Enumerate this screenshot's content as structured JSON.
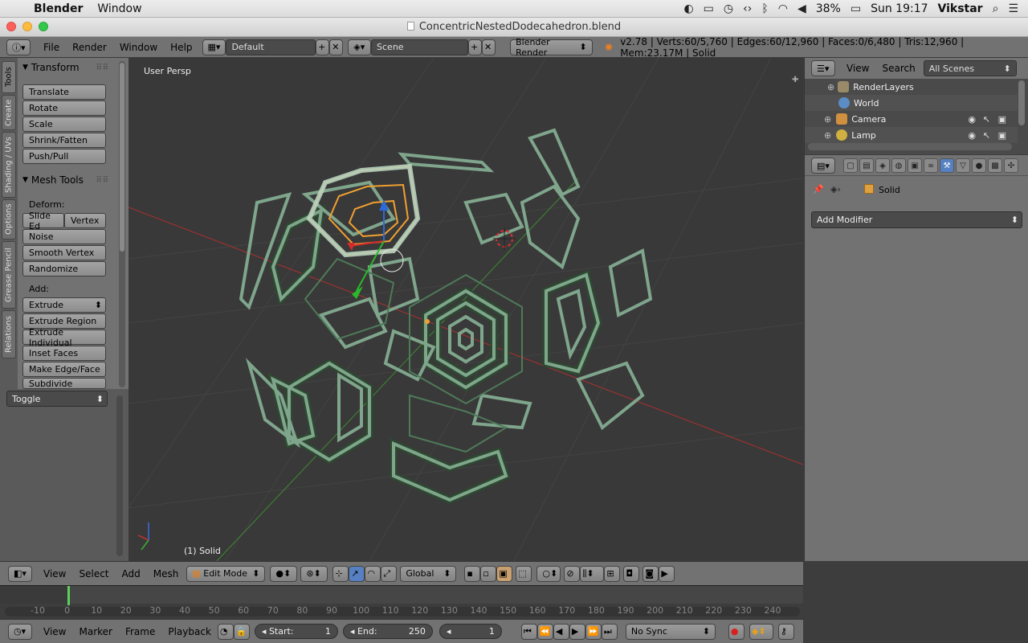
{
  "menubar": {
    "app_name": "Blender",
    "items": [
      "Window"
    ],
    "battery": "38%",
    "clock": "Sun 19:17",
    "user": "Vikstar"
  },
  "titlebar": {
    "title": "ConcentricNestedDodecahedron.blend"
  },
  "info_header": {
    "menus": [
      "File",
      "Render",
      "Window",
      "Help"
    ],
    "layout": "Default",
    "scene": "Scene",
    "engine": "Blender Render",
    "stats": "v2.78 | Verts:60/5,760 | Edges:60/12,960 | Faces:0/6,480 | Tris:12,960 | Mem:23.17M | Solid"
  },
  "tool_tabs": [
    "Tools",
    "Create",
    "Shading / UVs",
    "Options",
    "Grease Pencil",
    "Relations"
  ],
  "tool_shelf": {
    "transform_title": "Transform",
    "transform_buttons": [
      "Translate",
      "Rotate",
      "Scale",
      "Shrink/Fatten",
      "Push/Pull"
    ],
    "mesh_tools_title": "Mesh Tools",
    "deform_label": "Deform:",
    "slide_edge": "Slide Ed",
    "vertex": "Vertex",
    "deform_buttons": [
      "Noise",
      "Smooth Vertex",
      "Randomize"
    ],
    "add_label": "Add:",
    "extrude_select": "Extrude",
    "add_buttons": [
      "Extrude Region",
      "Extrude Individual",
      "Inset Faces",
      "Make Edge/Face",
      "Subdivide"
    ],
    "toggle": "Toggle"
  },
  "viewport": {
    "persp_label": "User Persp",
    "object_label": "(1) Solid"
  },
  "outliner": {
    "view": "View",
    "search": "Search",
    "scenes_select": "All Scenes",
    "rows": [
      "RenderLayers",
      "World",
      "Camera",
      "Lamp"
    ]
  },
  "properties": {
    "object_name": "Solid",
    "add_modifier": "Add Modifier"
  },
  "view3d_header": {
    "menus": [
      "View",
      "Select",
      "Add",
      "Mesh"
    ],
    "mode": "Edit Mode",
    "orientation": "Global"
  },
  "timeline": {
    "ticks": [
      "-10",
      "0",
      "10",
      "20",
      "30",
      "40",
      "50",
      "60",
      "70",
      "80",
      "90",
      "100",
      "110",
      "120",
      "130",
      "140",
      "150",
      "160",
      "170",
      "180",
      "190",
      "200",
      "210",
      "220",
      "230",
      "240"
    ],
    "current_frame": 1
  },
  "timeline_header": {
    "menus": [
      "View",
      "Marker",
      "Frame",
      "Playback"
    ],
    "start_label": "Start:",
    "start_value": "1",
    "end_label": "End:",
    "end_value": "250",
    "current": "1",
    "sync": "No Sync"
  },
  "colors": {
    "panel": "#727272",
    "viewport": "#393939",
    "mesh": "#7fa58c",
    "selected": "#f0a030",
    "axis_x": "#b23232",
    "axis_y": "#4ea03c"
  }
}
